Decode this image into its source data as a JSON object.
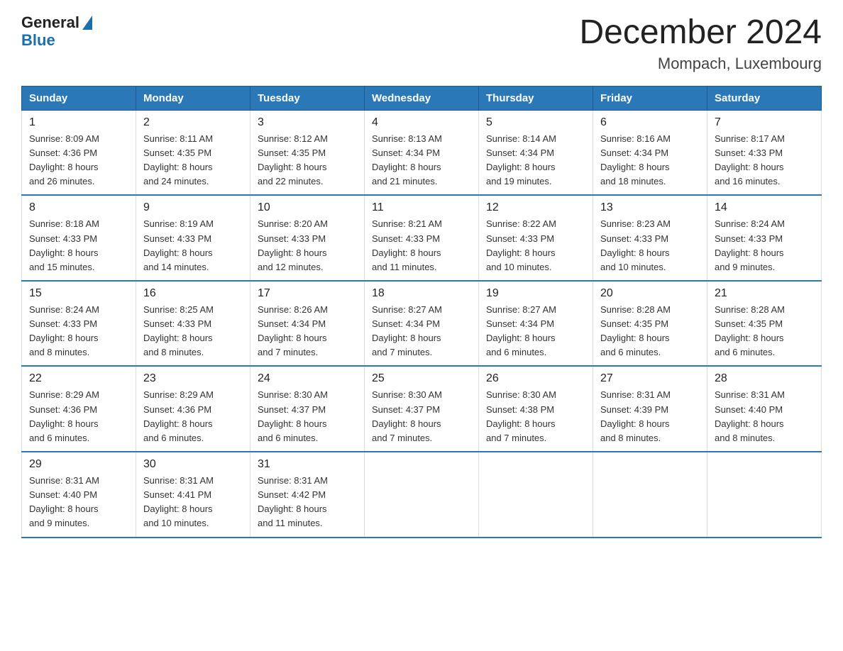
{
  "logo": {
    "general": "General",
    "blue": "Blue"
  },
  "title": "December 2024",
  "subtitle": "Mompach, Luxembourg",
  "days_of_week": [
    "Sunday",
    "Monday",
    "Tuesday",
    "Wednesday",
    "Thursday",
    "Friday",
    "Saturday"
  ],
  "weeks": [
    [
      {
        "day": "1",
        "sunrise": "8:09 AM",
        "sunset": "4:36 PM",
        "daylight": "8 hours and 26 minutes."
      },
      {
        "day": "2",
        "sunrise": "8:11 AM",
        "sunset": "4:35 PM",
        "daylight": "8 hours and 24 minutes."
      },
      {
        "day": "3",
        "sunrise": "8:12 AM",
        "sunset": "4:35 PM",
        "daylight": "8 hours and 22 minutes."
      },
      {
        "day": "4",
        "sunrise": "8:13 AM",
        "sunset": "4:34 PM",
        "daylight": "8 hours and 21 minutes."
      },
      {
        "day": "5",
        "sunrise": "8:14 AM",
        "sunset": "4:34 PM",
        "daylight": "8 hours and 19 minutes."
      },
      {
        "day": "6",
        "sunrise": "8:16 AM",
        "sunset": "4:34 PM",
        "daylight": "8 hours and 18 minutes."
      },
      {
        "day": "7",
        "sunrise": "8:17 AM",
        "sunset": "4:33 PM",
        "daylight": "8 hours and 16 minutes."
      }
    ],
    [
      {
        "day": "8",
        "sunrise": "8:18 AM",
        "sunset": "4:33 PM",
        "daylight": "8 hours and 15 minutes."
      },
      {
        "day": "9",
        "sunrise": "8:19 AM",
        "sunset": "4:33 PM",
        "daylight": "8 hours and 14 minutes."
      },
      {
        "day": "10",
        "sunrise": "8:20 AM",
        "sunset": "4:33 PM",
        "daylight": "8 hours and 12 minutes."
      },
      {
        "day": "11",
        "sunrise": "8:21 AM",
        "sunset": "4:33 PM",
        "daylight": "8 hours and 11 minutes."
      },
      {
        "day": "12",
        "sunrise": "8:22 AM",
        "sunset": "4:33 PM",
        "daylight": "8 hours and 10 minutes."
      },
      {
        "day": "13",
        "sunrise": "8:23 AM",
        "sunset": "4:33 PM",
        "daylight": "8 hours and 10 minutes."
      },
      {
        "day": "14",
        "sunrise": "8:24 AM",
        "sunset": "4:33 PM",
        "daylight": "8 hours and 9 minutes."
      }
    ],
    [
      {
        "day": "15",
        "sunrise": "8:24 AM",
        "sunset": "4:33 PM",
        "daylight": "8 hours and 8 minutes."
      },
      {
        "day": "16",
        "sunrise": "8:25 AM",
        "sunset": "4:33 PM",
        "daylight": "8 hours and 8 minutes."
      },
      {
        "day": "17",
        "sunrise": "8:26 AM",
        "sunset": "4:34 PM",
        "daylight": "8 hours and 7 minutes."
      },
      {
        "day": "18",
        "sunrise": "8:27 AM",
        "sunset": "4:34 PM",
        "daylight": "8 hours and 7 minutes."
      },
      {
        "day": "19",
        "sunrise": "8:27 AM",
        "sunset": "4:34 PM",
        "daylight": "8 hours and 6 minutes."
      },
      {
        "day": "20",
        "sunrise": "8:28 AM",
        "sunset": "4:35 PM",
        "daylight": "8 hours and 6 minutes."
      },
      {
        "day": "21",
        "sunrise": "8:28 AM",
        "sunset": "4:35 PM",
        "daylight": "8 hours and 6 minutes."
      }
    ],
    [
      {
        "day": "22",
        "sunrise": "8:29 AM",
        "sunset": "4:36 PM",
        "daylight": "8 hours and 6 minutes."
      },
      {
        "day": "23",
        "sunrise": "8:29 AM",
        "sunset": "4:36 PM",
        "daylight": "8 hours and 6 minutes."
      },
      {
        "day": "24",
        "sunrise": "8:30 AM",
        "sunset": "4:37 PM",
        "daylight": "8 hours and 6 minutes."
      },
      {
        "day": "25",
        "sunrise": "8:30 AM",
        "sunset": "4:37 PM",
        "daylight": "8 hours and 7 minutes."
      },
      {
        "day": "26",
        "sunrise": "8:30 AM",
        "sunset": "4:38 PM",
        "daylight": "8 hours and 7 minutes."
      },
      {
        "day": "27",
        "sunrise": "8:31 AM",
        "sunset": "4:39 PM",
        "daylight": "8 hours and 8 minutes."
      },
      {
        "day": "28",
        "sunrise": "8:31 AM",
        "sunset": "4:40 PM",
        "daylight": "8 hours and 8 minutes."
      }
    ],
    [
      {
        "day": "29",
        "sunrise": "8:31 AM",
        "sunset": "4:40 PM",
        "daylight": "8 hours and 9 minutes."
      },
      {
        "day": "30",
        "sunrise": "8:31 AM",
        "sunset": "4:41 PM",
        "daylight": "8 hours and 10 minutes."
      },
      {
        "day": "31",
        "sunrise": "8:31 AM",
        "sunset": "4:42 PM",
        "daylight": "8 hours and 11 minutes."
      },
      null,
      null,
      null,
      null
    ]
  ],
  "labels": {
    "sunrise": "Sunrise:",
    "sunset": "Sunset:",
    "daylight": "Daylight:"
  }
}
